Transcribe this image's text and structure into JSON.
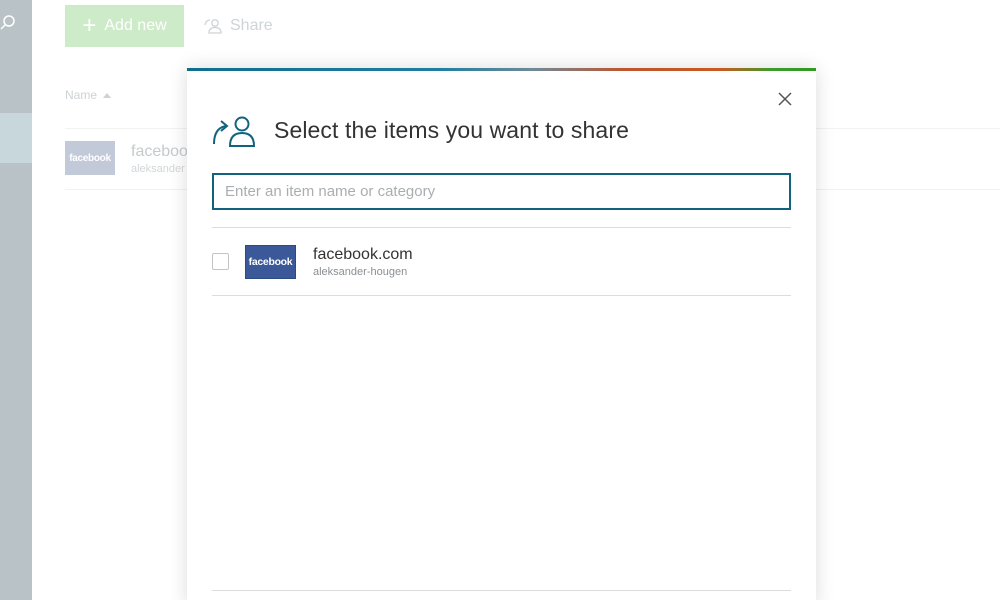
{
  "background": {
    "toolbar": {
      "add_label": "Add new",
      "add_icon": "plus-icon",
      "share_label": "Share",
      "share_icon": "share-user-icon"
    },
    "table": {
      "column_name": "Name",
      "rows": [
        {
          "logo_text": "facebook",
          "title": "faceboo",
          "subtitle": "aleksander"
        }
      ]
    }
  },
  "modal": {
    "title": "Select the items you want to share",
    "search": {
      "placeholder": "Enter an item name or category",
      "value": ""
    },
    "items": [
      {
        "logo_text": "facebook",
        "title": "facebook.com",
        "subtitle": "aleksander-hougen",
        "checked": false
      }
    ],
    "colors": {
      "accent": "#11637d",
      "facebook_blue": "#3b5998",
      "add_button": "#cdebc8"
    }
  }
}
